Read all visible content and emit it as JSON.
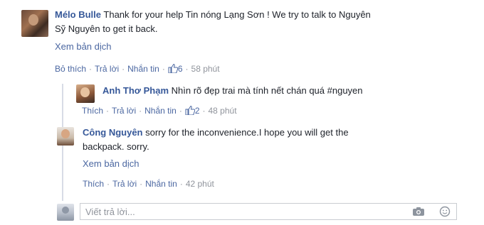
{
  "comment": {
    "author": "Mélo Bulle",
    "text_line1": "Thank for your help Tin nóng Lạng Sơn ! We try to talk to Nguyên",
    "text_line2": "Sỹ Nguyên to get it back.",
    "translate": "Xem bản dịch",
    "actions": {
      "unlike": "Bỏ thích",
      "reply": "Trả lời",
      "message": "Nhắn tin",
      "likes": "6",
      "time": "58 phút"
    }
  },
  "replies": [
    {
      "author": "Anh Thơ Phạm",
      "text": "Nhìn rõ đẹp trai mà tính nết chán quá #nguyen",
      "actions": {
        "like": "Thích",
        "reply": "Trả lời",
        "message": "Nhắn tin",
        "likes": "2",
        "time": "48 phút"
      }
    },
    {
      "author": "Công Nguyên",
      "text_line1": "sorry for the inconvenience.I hope you will get the",
      "text_line2": "backpack. sorry.",
      "translate": "Xem bản dịch",
      "actions": {
        "like": "Thích",
        "reply": "Trả lời",
        "message": "Nhắn tin",
        "time": "42 phút"
      }
    }
  ],
  "reply_input": {
    "placeholder": "Viết trả lời..."
  },
  "icons": {
    "like": "thumbs-up-icon",
    "camera": "camera-icon",
    "emoji": "smiley-icon"
  }
}
